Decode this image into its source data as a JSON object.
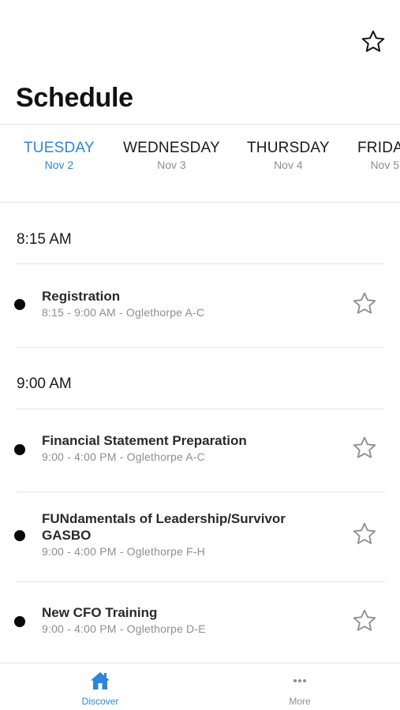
{
  "header": {
    "title": "Schedule",
    "favorites_icon": "star-outline-icon"
  },
  "days": [
    {
      "day": "TUESDAY",
      "date": "Nov 2",
      "active": true
    },
    {
      "day": "WEDNESDAY",
      "date": "Nov 3",
      "active": false
    },
    {
      "day": "THURSDAY",
      "date": "Nov 4",
      "active": false
    },
    {
      "day": "FRIDAY",
      "date": "Nov 5",
      "active": false
    }
  ],
  "time_slots": [
    {
      "time": "8:15 AM",
      "sessions": [
        {
          "title": "Registration",
          "details": "8:15 - 9:00 AM - Oglethorpe A-C"
        }
      ]
    },
    {
      "time": "9:00 AM",
      "sessions": [
        {
          "title": "Financial Statement Preparation",
          "details": "9:00 - 4:00 PM - Oglethorpe A-C"
        },
        {
          "title": "FUNdamentals of Leadership/Survivor GASBO",
          "details": "9:00 - 4:00 PM - Oglethorpe F-H"
        },
        {
          "title": "New CFO Training",
          "details": "9:00 - 4:00 PM - Oglethorpe D-E"
        }
      ]
    }
  ],
  "tab_bar": {
    "items": [
      {
        "label": "Discover",
        "icon": "home-icon",
        "active": true
      },
      {
        "label": "More",
        "icon": "more-dots-icon",
        "active": false
      }
    ]
  },
  "colors": {
    "accent": "#2d86d8",
    "inactive": "#8e8e93",
    "text": "#1a1a1a",
    "divider": "#e4e4e4"
  }
}
